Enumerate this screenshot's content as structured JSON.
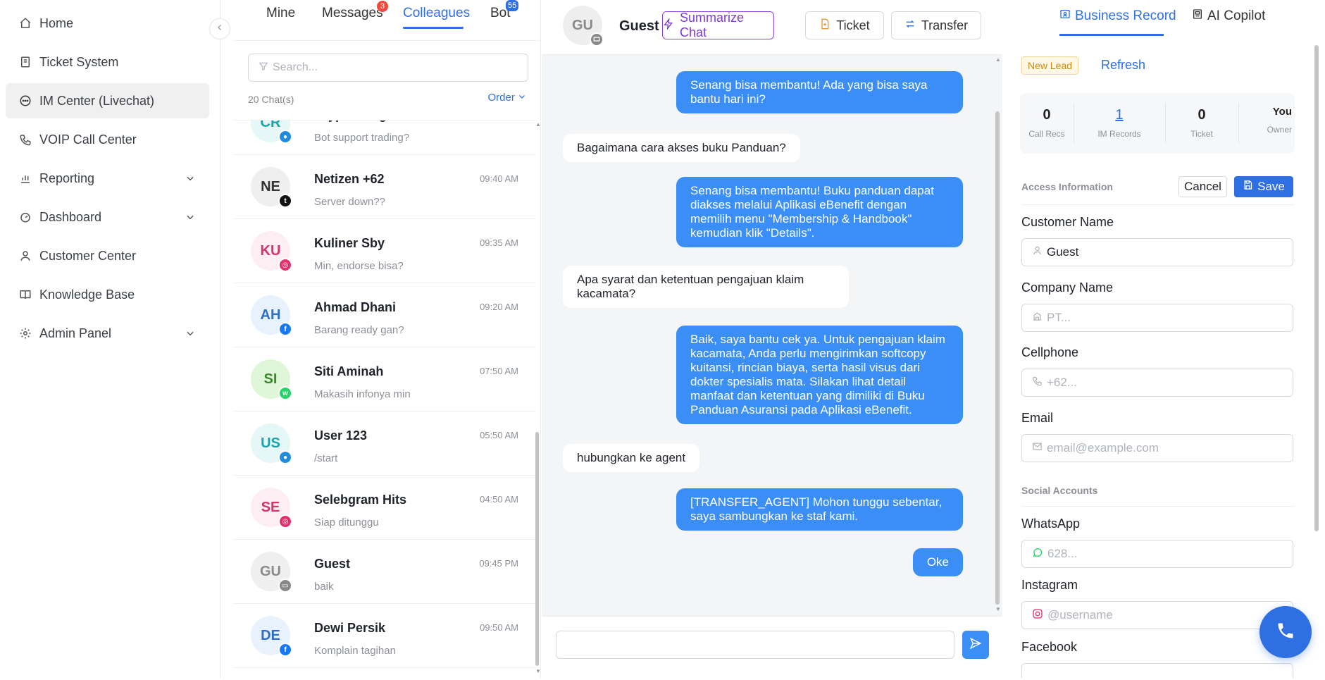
{
  "sidebar": {
    "items": [
      {
        "label": "Home",
        "icon": "home-icon"
      },
      {
        "label": "Ticket System",
        "icon": "ticket-icon"
      },
      {
        "label": "IM Center (Livechat)",
        "icon": "chat-icon"
      },
      {
        "label": "VOIP Call Center",
        "icon": "phone-icon"
      },
      {
        "label": "Reporting",
        "icon": "bar-chart-icon"
      },
      {
        "label": "Dashboard",
        "icon": "dashboard-icon"
      },
      {
        "label": "Customer Center",
        "icon": "user-icon"
      },
      {
        "label": "Knowledge Base",
        "icon": "book-icon"
      },
      {
        "label": "Admin Panel",
        "icon": "gear-icon"
      }
    ],
    "active": "IM Center (Livechat)"
  },
  "chatlist": {
    "tabs": [
      {
        "label": "Mine",
        "badge": ""
      },
      {
        "label": "Messages",
        "badge": "3"
      },
      {
        "label": "Colleagues",
        "badge": ""
      },
      {
        "label": "Bot",
        "badge": "55"
      }
    ],
    "active_tab": "Colleagues",
    "search_placeholder": "Search...",
    "count_label": "20 Chat(s)",
    "order_label": "Order",
    "rows": [
      {
        "initials": "CR",
        "name": "Crypto King",
        "message": "Bot support trading?",
        "time": "",
        "channel": "chat",
        "avatar_bg": "#e6f7f8",
        "avatar_fg": "#1ba3ab",
        "channel_color": "#1f8ce0"
      },
      {
        "initials": "NE",
        "name": "Netizen +62",
        "message": "Server down??",
        "time": "09:40 AM",
        "channel": "twitter",
        "avatar_bg": "#efefef",
        "avatar_fg": "#333333",
        "channel_color": "#111111"
      },
      {
        "initials": "KU",
        "name": "Kuliner Sby",
        "message": "Min, endorse bisa?",
        "time": "09:35 AM",
        "channel": "instagram",
        "avatar_bg": "#fdeef3",
        "avatar_fg": "#d4336b",
        "channel_color": "#e1306c"
      },
      {
        "initials": "AH",
        "name": "Ahmad Dhani",
        "message": "Barang ready gan?",
        "time": "09:20 AM",
        "channel": "facebook",
        "avatar_bg": "#e8f2fd",
        "avatar_fg": "#2d6ec9",
        "channel_color": "#1877f2"
      },
      {
        "initials": "SI",
        "name": "Siti Aminah",
        "message": "Makasih infonya min",
        "time": "07:50 AM",
        "channel": "whatsapp",
        "avatar_bg": "#dff6d8",
        "avatar_fg": "#3b8a2a",
        "channel_color": "#25d366"
      },
      {
        "initials": "US",
        "name": "User 123",
        "message": "/start",
        "time": "05:50 AM",
        "channel": "chat",
        "avatar_bg": "#e6f7f8",
        "avatar_fg": "#1ba3ab",
        "channel_color": "#1f8ce0"
      },
      {
        "initials": "SE",
        "name": "Selebgram Hits",
        "message": "Siap ditunggu",
        "time": "04:50 AM",
        "channel": "instagram",
        "avatar_bg": "#fdeef3",
        "avatar_fg": "#d4336b",
        "channel_color": "#e1306c"
      },
      {
        "initials": "GU",
        "name": "Guest",
        "message": "baik",
        "time": "09:45 PM",
        "channel": "web",
        "avatar_bg": "#efefef",
        "avatar_fg": "#8a8a8a",
        "channel_color": "#888888"
      },
      {
        "initials": "DE",
        "name": "Dewi Persik",
        "message": "Komplain tagihan",
        "time": "09:50 AM",
        "channel": "facebook",
        "avatar_bg": "#e8f2fd",
        "avatar_fg": "#2d6ec9",
        "channel_color": "#1877f2"
      }
    ]
  },
  "chat": {
    "contact_initials": "GU",
    "contact_name": "Guest",
    "buttons": {
      "summarize": "Summarize Chat",
      "ticket": "Ticket",
      "transfer": "Transfer"
    },
    "messages": [
      {
        "from": "agent",
        "text": "Senang bisa membantu! Ada yang bisa saya\nbantu hari ini?"
      },
      {
        "from": "customer",
        "text": "Bagaimana cara akses buku Panduan?"
      },
      {
        "from": "agent",
        "text": "Senang bisa membantu! Buku panduan dapat\ndiakses melalui Aplikasi eBenefit dengan\nmemilih menu \"Membership & Handbook\"\nkemudian klik \"Details\"."
      },
      {
        "from": "customer",
        "text": "Apa syarat dan ketentuan pengajuan klaim\nkacamata?"
      },
      {
        "from": "agent",
        "text": "Baik, saya bantu cek ya. Untuk pengajuan klaim\nkacamata, Anda perlu mengirimkan softcopy\nkuitansi, rincian biaya, serta hasil visus dari\ndokter spesialis mata. Silakan lihat detail\nmanfaat dan ketentuan yang dimiliki di Buku\nPanduan Asuransi pada Aplikasi eBenefit."
      },
      {
        "from": "customer",
        "text": "hubungkan ke agent"
      },
      {
        "from": "agent",
        "text": "[TRANSFER_AGENT] Mohon tunggu sebentar,\nsaya sambungkan ke staf kami."
      },
      {
        "from": "agent",
        "text": "Oke"
      }
    ],
    "input_value": ""
  },
  "record": {
    "tabs": [
      {
        "label": "Business Record",
        "icon": "record-icon"
      },
      {
        "label": "AI Copilot",
        "icon": "copilot-icon"
      }
    ],
    "active_tab": "Business Record",
    "tag": "New Lead",
    "refresh": "Refresh",
    "stats": [
      {
        "value": "0",
        "label": "Call Recs"
      },
      {
        "value": "1",
        "label": "IM Records"
      },
      {
        "value": "0",
        "label": "Ticket"
      },
      {
        "value": "You",
        "label": "Owner"
      }
    ],
    "access_title": "Access Information",
    "cancel": "Cancel",
    "save": "Save",
    "fields": {
      "customer_name": {
        "label": "Customer Name",
        "value": "Guest"
      },
      "company_name": {
        "label": "Company Name",
        "placeholder": "PT..."
      },
      "cellphone": {
        "label": "Cellphone",
        "placeholder": "+62..."
      },
      "email": {
        "label": "Email",
        "placeholder": "email@example.com"
      }
    },
    "social_title": "Social Accounts",
    "social": {
      "whatsapp": {
        "label": "WhatsApp",
        "placeholder": "628..."
      },
      "instagram": {
        "label": "Instagram",
        "placeholder": "@username"
      },
      "facebook": {
        "label": "Facebook",
        "placeholder": ""
      }
    }
  },
  "colors": {
    "accent": "#2f6fe4",
    "bubble": "#3a8ef6",
    "purple": "#7c3bd1"
  }
}
